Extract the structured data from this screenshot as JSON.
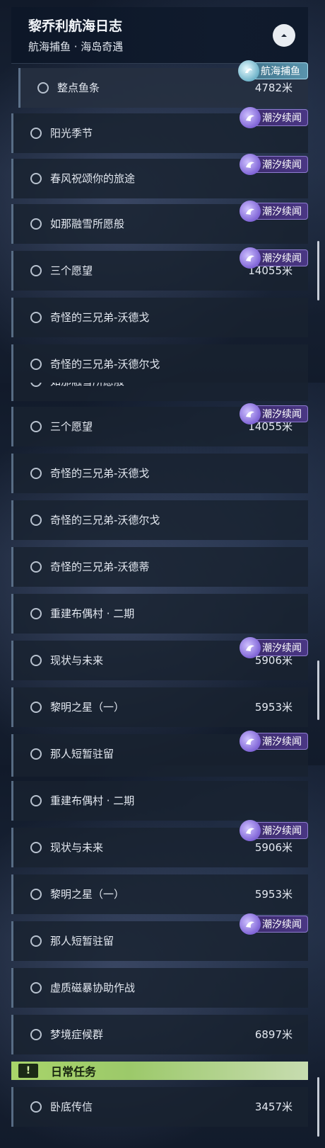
{
  "header": {
    "title": "黎乔利航海日志",
    "subtitle": "航海捕鱼 · 海岛奇遇"
  },
  "tags": {
    "tide": "潮汐续闻",
    "fishing": "航海捕鱼"
  },
  "quests": {
    "fishing": {
      "label": "整点鱼条",
      "dist": "4782米"
    },
    "sunshine": {
      "label": "阳光季节",
      "dist": ""
    },
    "spring": {
      "label": "春风祝颂你的旅途",
      "dist": ""
    },
    "snow": {
      "label": "如那融雪所愿般",
      "dist": ""
    },
    "three_wishes": {
      "label": "三个愿望",
      "dist": "14055米"
    },
    "brother_1": {
      "label": "奇怪的三兄弟-沃德戈",
      "dist": ""
    },
    "brother_2": {
      "label": "奇怪的三兄弟-沃德尔戈",
      "dist": ""
    },
    "brother_3": {
      "label": "奇怪的三兄弟-沃德蒂",
      "dist": ""
    },
    "rebuild": {
      "label": "重建布偶村 · 二期",
      "dist": ""
    },
    "status_future": {
      "label": "现状与未来",
      "dist": "5906米"
    },
    "dawn_star": {
      "label": "黎明之星（一）",
      "dist": "5953米"
    },
    "brief_stay": {
      "label": "那人短暂驻留",
      "dist": ""
    },
    "storm": {
      "label": "虚质磁暴协助作战",
      "dist": ""
    },
    "dream": {
      "label": "梦境症候群",
      "dist": "6897米"
    },
    "undercover": {
      "label": "卧底传信",
      "dist": "3457米"
    }
  },
  "daily": {
    "title": "日常任务",
    "icon": "!"
  }
}
